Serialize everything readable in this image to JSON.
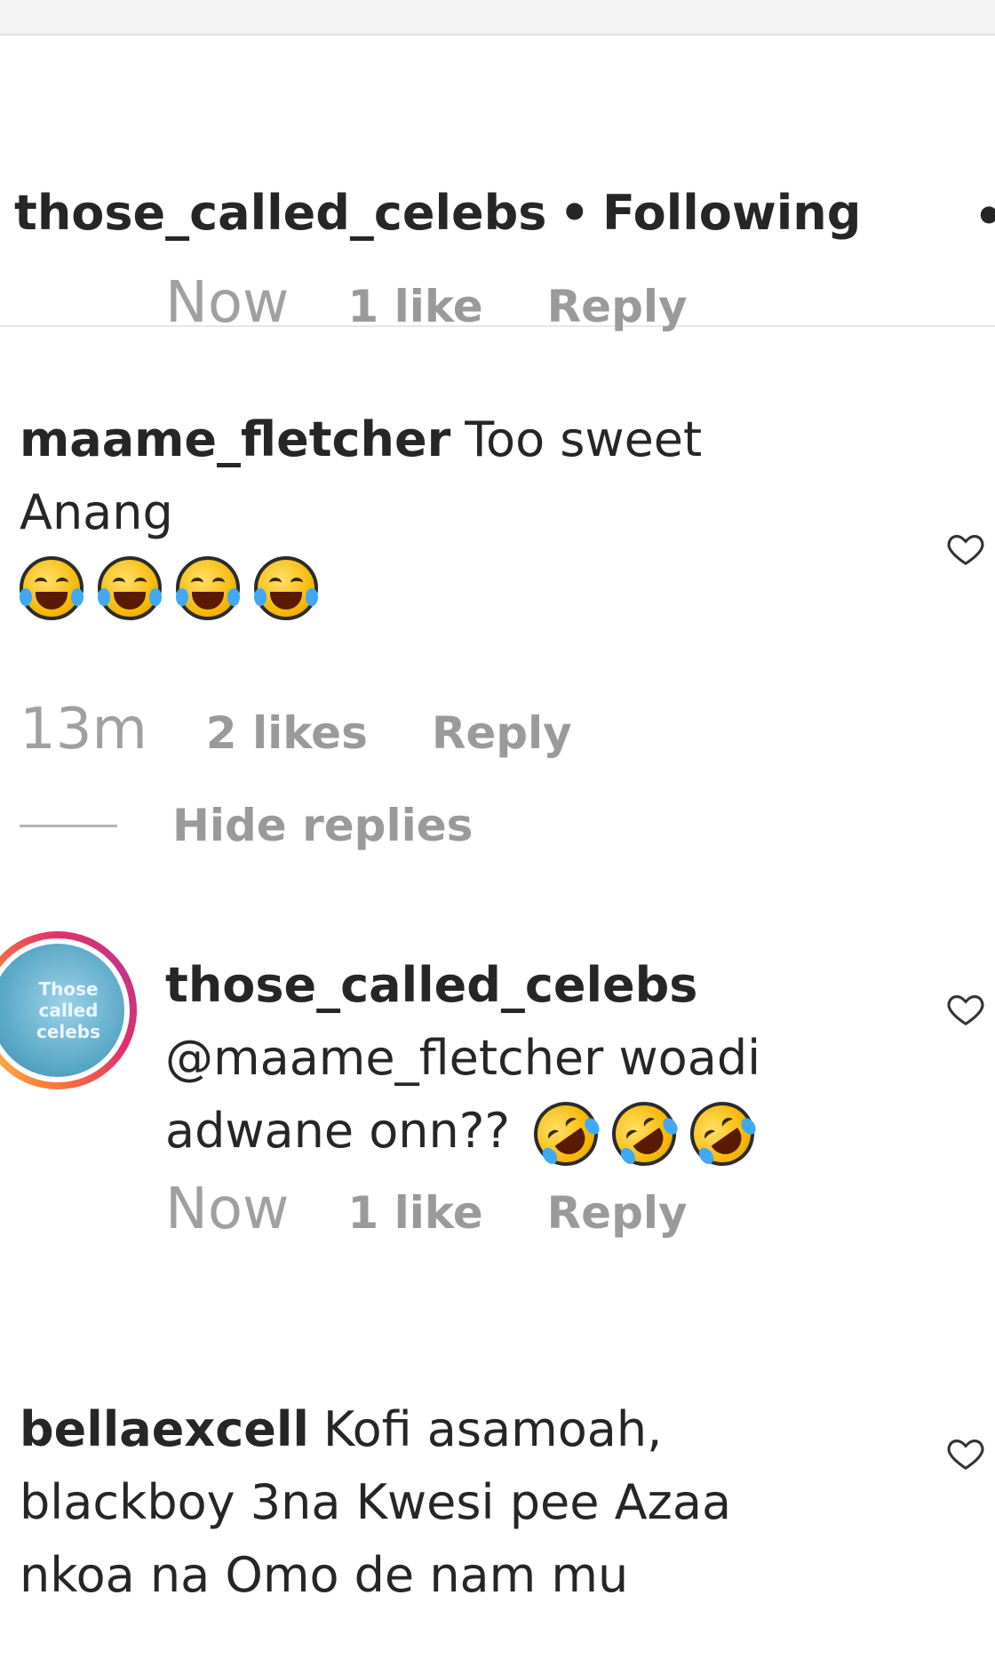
{
  "post_header": {
    "username": "those_called_celebs",
    "separator": "•",
    "follow_status": "Following",
    "menu_glyph": "•"
  },
  "comments": [
    {
      "meta": {
        "time": "Now",
        "likes": "1 like",
        "reply": "Reply"
      }
    },
    {
      "username": "maame_fletcher",
      "text": "Too sweet Anang",
      "emoji": [
        "joy",
        "joy",
        "joy",
        "joy"
      ],
      "meta": {
        "time": "13m",
        "likes": "2 likes",
        "reply": "Reply"
      },
      "hide_replies": "Hide replies",
      "reply": {
        "username": "those_called_celebs",
        "avatar_text": "Those called celebs",
        "text_line1": "@maame_fletcher woadi",
        "text_line2": "adwane onn??",
        "emoji": [
          "rofl",
          "rofl",
          "rofl"
        ],
        "meta": {
          "time": "Now",
          "likes": "1 like",
          "reply": "Reply"
        }
      }
    },
    {
      "username": "bellaexcell",
      "text_line1": "Kofi asamoah,",
      "text_line2": "blackboy 3na Kwesi pee Azaa",
      "text_line3": "nkoa na Omo de nam mu"
    }
  ],
  "icons": {
    "heart": "heart-outline-icon",
    "emoji_joy": "face-with-tears-of-joy",
    "emoji_rofl": "rolling-on-the-floor-laughing"
  },
  "colors": {
    "text": "#262626",
    "muted": "#8e8e8e",
    "ring": "#e1306c"
  }
}
